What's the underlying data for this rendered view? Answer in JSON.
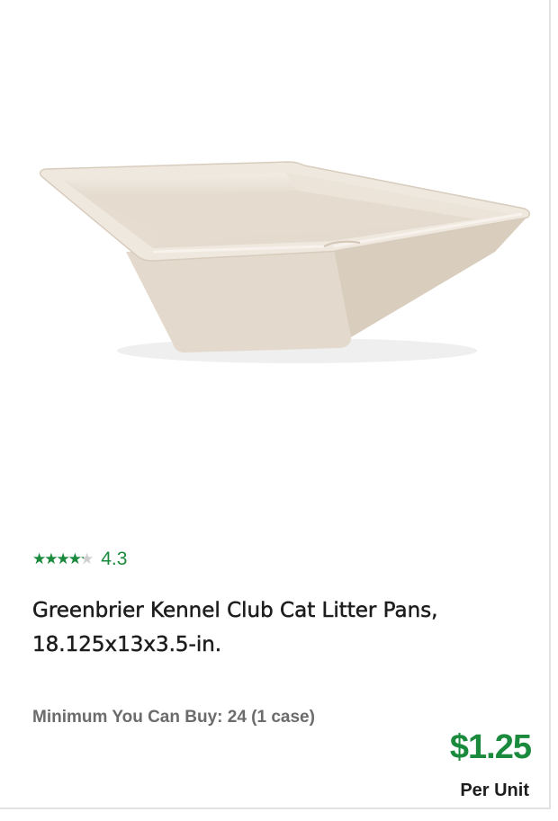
{
  "product": {
    "image_icon": "litter-pan-image",
    "rating": {
      "value": "4.3",
      "score": 4.3,
      "max": 5,
      "stars_glyphs": "★★★★★",
      "star_color": "#1a8a3d",
      "empty_star_color": "#cfcfcf"
    },
    "title": "Greenbrier Kennel Club Cat Litter Pans, 18.125x13x3.5-in.",
    "minimum": "Minimum You Can Buy: 24 (1 case)",
    "price": "$1.25",
    "price_unit": "Per Unit",
    "price_color": "#1a8a3d"
  }
}
